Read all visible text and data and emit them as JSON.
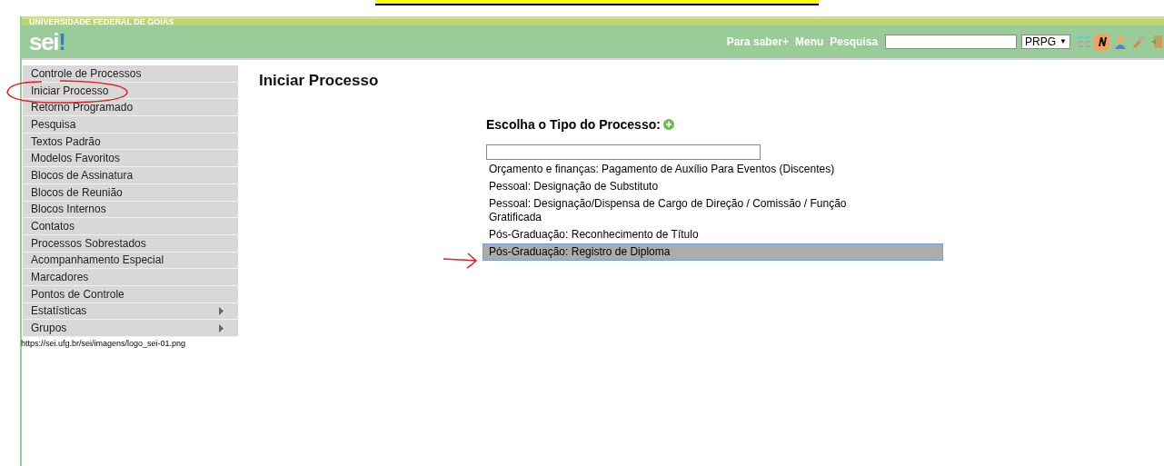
{
  "header": {
    "organization": "UNIVERSIDADE FEDERAL DE GOIÁS",
    "logo": {
      "text": "sei",
      "mark": "!"
    },
    "links": [
      "Para saber+",
      "Menu",
      "Pesquisa"
    ],
    "unit_select": {
      "value": "PRPG",
      "arrow": "▼"
    }
  },
  "sidebar": {
    "items": [
      {
        "label": "Controle de Processos",
        "submenu": false
      },
      {
        "label": "Iniciar Processo",
        "submenu": false
      },
      {
        "label": "Retorno Programado",
        "submenu": false
      },
      {
        "label": "Pesquisa",
        "submenu": false
      },
      {
        "label": "Textos Padrão",
        "submenu": false
      },
      {
        "label": "Modelos Favoritos",
        "submenu": false
      },
      {
        "label": "Blocos de Assinatura",
        "submenu": false
      },
      {
        "label": "Blocos de Reunião",
        "submenu": false
      },
      {
        "label": "Blocos Internos",
        "submenu": false
      },
      {
        "label": "Contatos",
        "submenu": false
      },
      {
        "label": "Processos Sobrestados",
        "submenu": false
      },
      {
        "label": "Acompanhamento Especial",
        "submenu": false
      },
      {
        "label": "Marcadores",
        "submenu": false
      },
      {
        "label": "Pontos de Controle",
        "submenu": false
      },
      {
        "label": "Estatísticas",
        "submenu": true
      },
      {
        "label": "Grupos",
        "submenu": true
      }
    ],
    "status_url": "https://sei.ufg.br/sei/imagens/logo_sei-01.png"
  },
  "page": {
    "title": "Iniciar Processo",
    "chooser_label": "Escolha o Tipo do Processo:",
    "process_types": [
      {
        "label": "Orçamento e finanças: Pagamento de Auxílio Para Eventos (Discentes)",
        "selected": false
      },
      {
        "label": "Pessoal: Designação de Substituto",
        "selected": false
      },
      {
        "label": "Pessoal: Designação/Dispensa de Cargo de Direção / Comissão / Função Gratificada",
        "selected": false
      },
      {
        "label": "Pós-Graduação: Reconhecimento de Título",
        "selected": false
      },
      {
        "label": "Pós-Graduação: Registro de Diploma",
        "selected": true
      }
    ]
  }
}
